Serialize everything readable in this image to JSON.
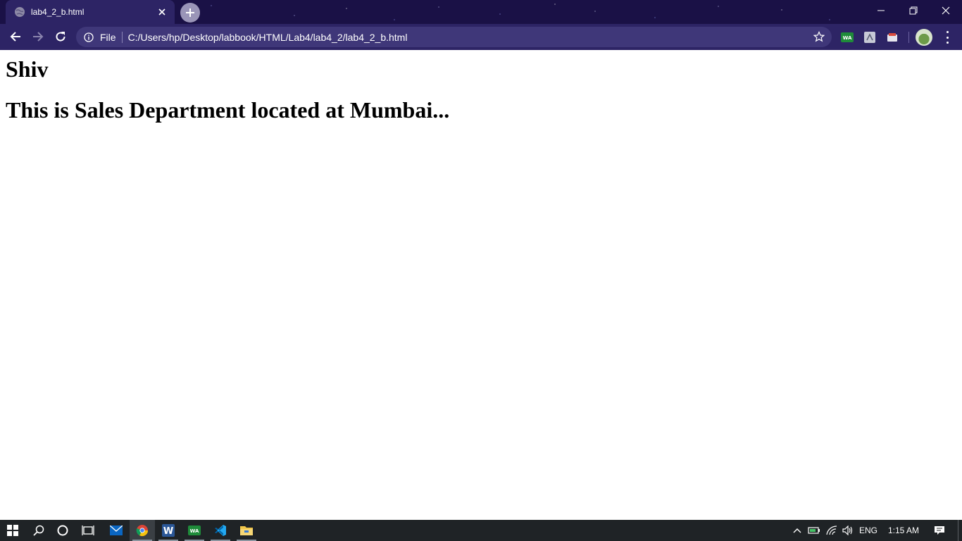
{
  "browser": {
    "tab": {
      "title": "lab4_2_b.html",
      "favicon": "globe-icon"
    },
    "new_tab_icon": "plus-icon",
    "window_controls": [
      "minimize-icon",
      "restore-icon",
      "close-icon"
    ],
    "toolbar": {
      "back_icon": "back-arrow-icon",
      "forward_icon": "forward-arrow-icon",
      "reload_icon": "reload-icon",
      "address": {
        "scheme_label": "File",
        "url": "C:/Users/hp/Desktop/labbook/HTML/Lab4/lab4_2/lab4_2_b.html"
      },
      "bookmark_icon": "star-icon",
      "extensions": [
        {
          "name": "wa-extension-icon",
          "label": "WA"
        },
        {
          "name": "extension-icon"
        },
        {
          "name": "cast-extension-icon"
        }
      ],
      "menu_icon": "kebab-menu-icon"
    }
  },
  "page": {
    "heading_name": "Shiv",
    "heading_department": "This is Sales Department located at Mumbai..."
  },
  "taskbar": {
    "apps": [
      {
        "name": "start-icon"
      },
      {
        "name": "search-icon"
      },
      {
        "name": "cortana-icon"
      },
      {
        "name": "task-view-icon"
      },
      {
        "name": "mail-icon"
      },
      {
        "name": "chrome-icon",
        "active": true
      },
      {
        "name": "word-icon",
        "label": "W"
      },
      {
        "name": "whatsapp-icon",
        "label": "WA"
      },
      {
        "name": "vscode-icon"
      },
      {
        "name": "file-explorer-icon"
      }
    ],
    "tray": {
      "language": "ENG",
      "time": "1:15 AM"
    }
  },
  "colors": {
    "titlebar": "#1a1146",
    "toolbar": "#2d2465",
    "omnibox": "#3f3779",
    "taskbar": "#1f2326"
  }
}
